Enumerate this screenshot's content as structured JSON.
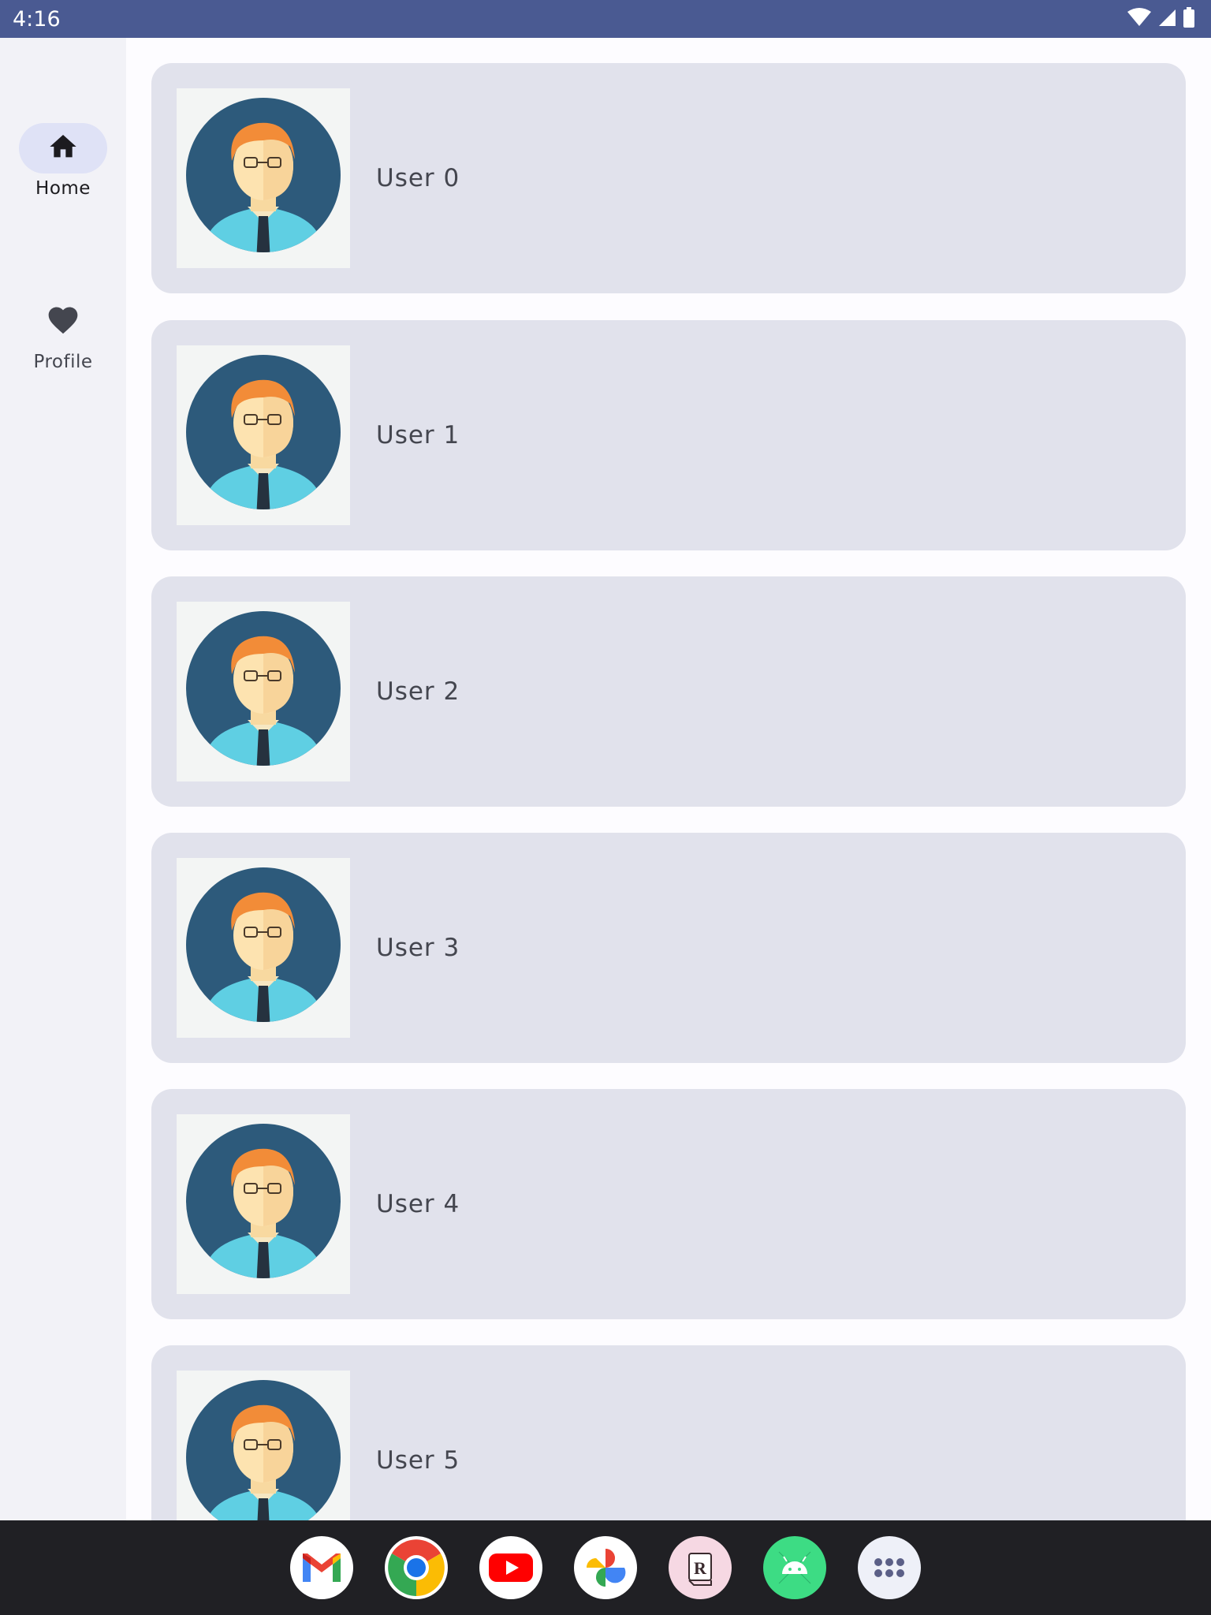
{
  "status_bar": {
    "time": "4:16",
    "icons": [
      "wifi-icon",
      "signal-icon",
      "battery-icon"
    ]
  },
  "nav_rail": {
    "items": [
      {
        "label": "Home",
        "icon": "home-icon",
        "selected": true
      },
      {
        "label": "Profile",
        "icon": "heart-icon",
        "selected": false
      }
    ]
  },
  "user_list": {
    "items": [
      {
        "label": "User 0",
        "avatar": "user-avatar-icon"
      },
      {
        "label": "User 1",
        "avatar": "user-avatar-icon"
      },
      {
        "label": "User 2",
        "avatar": "user-avatar-icon"
      },
      {
        "label": "User 3",
        "avatar": "user-avatar-icon"
      },
      {
        "label": "User 4",
        "avatar": "user-avatar-icon"
      },
      {
        "label": "User 5",
        "avatar": "user-avatar-icon"
      }
    ]
  },
  "taskbar": {
    "apps": [
      "gmail-icon",
      "chrome-icon",
      "youtube-icon",
      "photos-icon",
      "r-app-icon",
      "android-app-icon",
      "app-drawer-icon"
    ]
  },
  "colors": {
    "status_bar": "#4a5a92",
    "nav_rail": "#f2f2f7",
    "nav_selected_pill": "#dfe2f6",
    "card": "#e1e2ec",
    "taskbar": "#202024"
  }
}
